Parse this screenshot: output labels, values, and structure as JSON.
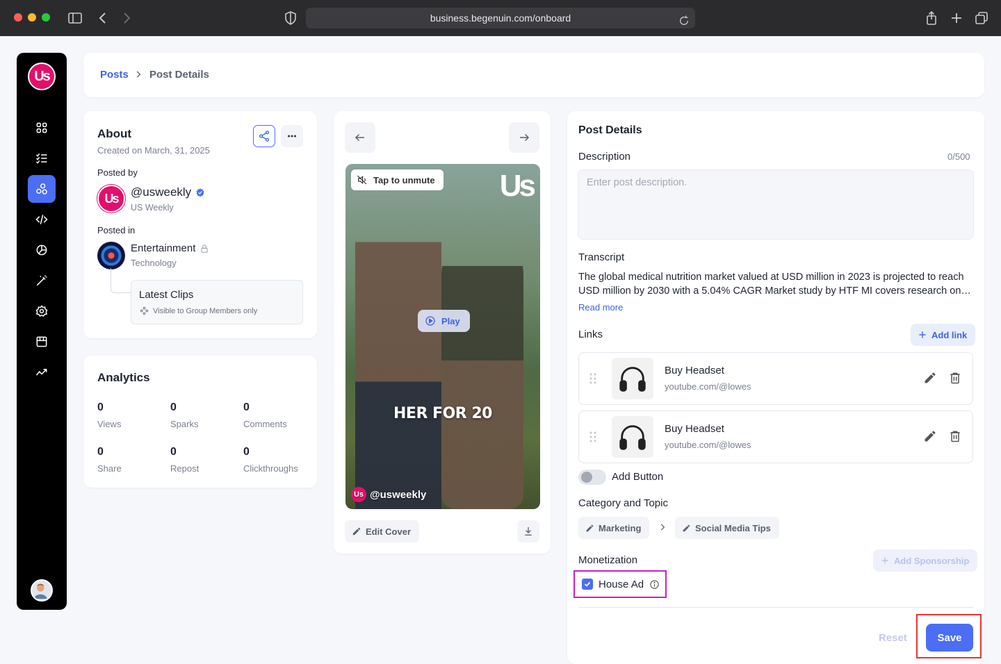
{
  "browser": {
    "url": "business.begenuin.com/onboard"
  },
  "sidebar": {
    "logo_text": "Us",
    "items": [
      {
        "icon": "grid-icon"
      },
      {
        "icon": "list-icon"
      },
      {
        "icon": "community-icon",
        "active": true
      },
      {
        "icon": "code-icon"
      },
      {
        "icon": "analytics-pie-icon"
      },
      {
        "icon": "magic-wand-icon"
      },
      {
        "icon": "settings-icon"
      },
      {
        "icon": "store-icon"
      },
      {
        "icon": "trend-icon"
      }
    ]
  },
  "breadcrumb": {
    "parent": "Posts",
    "current": "Post Details"
  },
  "about": {
    "title": "About",
    "created": "Created on March, 31, 2025",
    "posted_by_label": "Posted by",
    "author_handle": "@usweekly",
    "author_name": "US Weekly",
    "posted_in_label": "Posted in",
    "community_name": "Entertainment",
    "community_category": "Technology",
    "clip_title": "Latest Clips",
    "clip_visibility": "Visible to Group Members only"
  },
  "analytics": {
    "title": "Analytics",
    "stats": [
      {
        "value": "0",
        "label": "Views"
      },
      {
        "value": "0",
        "label": "Sparks"
      },
      {
        "value": "0",
        "label": "Comments"
      },
      {
        "value": "0",
        "label": "Share"
      },
      {
        "value": "0",
        "label": "Repost"
      },
      {
        "value": "0",
        "label": "Clickthroughs"
      }
    ]
  },
  "media": {
    "unmute_label": "Tap to unmute",
    "brand_mark": "Us",
    "play_label": "Play",
    "caption": "HER FOR 20",
    "handle": "@usweekly",
    "edit_cover_label": "Edit Cover"
  },
  "details": {
    "title": "Post Details",
    "description_label": "Description",
    "description_counter": "0/500",
    "description_placeholder": "Enter post description.",
    "transcript_label": "Transcript",
    "transcript_text": "The global medical nutrition market valued at USD million in 2023 is projected to reach USD million by 2030 with a 5.04% CAGR Market study by HTF MI covers research on key players, segments and regional trends.",
    "read_more": "Read more",
    "links_label": "Links",
    "add_link_label": "Add link",
    "links": [
      {
        "title": "Buy Headset",
        "url": "youtube.com/@lowes"
      },
      {
        "title": "Buy Headset",
        "url": "youtube.com/@lowes"
      }
    ],
    "add_button_label": "Add Button",
    "add_button_enabled": false,
    "category_label": "Category and Topic",
    "category": "Marketing",
    "topic": "Social Media Tips",
    "monetization_label": "Monetization",
    "add_sponsorship_label": "Add Sponsorship",
    "house_ad_label": "House Ad",
    "house_ad_checked": true,
    "reset_label": "Reset",
    "save_label": "Save"
  },
  "colors": {
    "accent": "#4b6ef5",
    "brand": "#e40f6b",
    "highlight_magenta": "#c620c7",
    "highlight_red": "#e53535"
  }
}
